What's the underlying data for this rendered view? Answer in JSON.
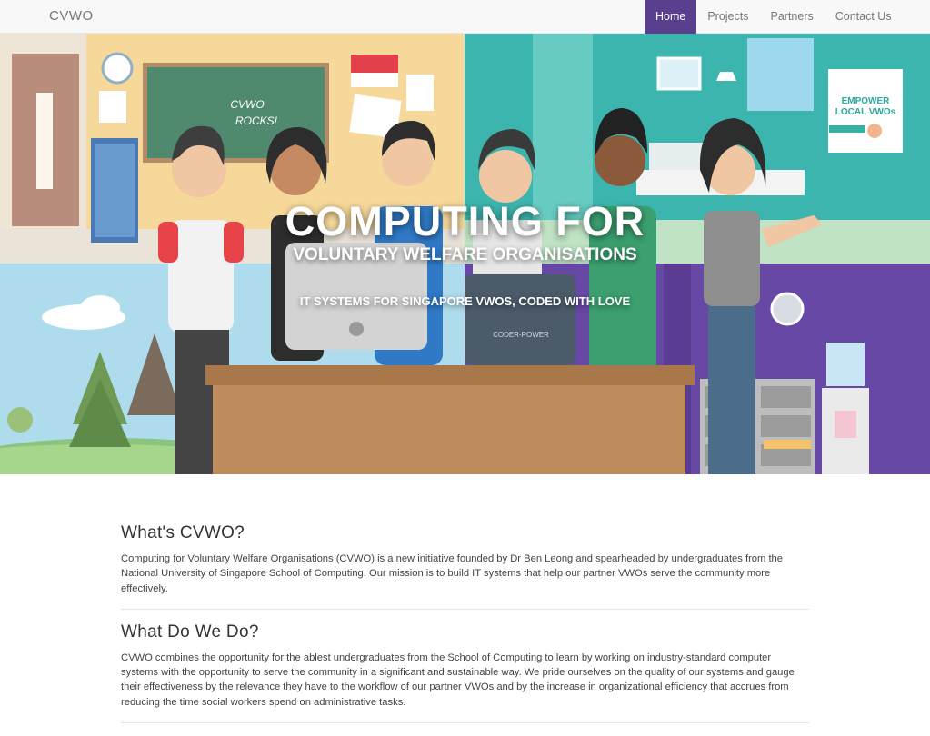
{
  "navbar": {
    "brand": "CVWO",
    "items": [
      {
        "label": "Home",
        "active": true
      },
      {
        "label": "Projects",
        "active": false
      },
      {
        "label": "Partners",
        "active": false
      },
      {
        "label": "Contact Us",
        "active": false
      }
    ],
    "active_color": "#5b3f8f"
  },
  "hero": {
    "title": "COMPUTING FOR",
    "subtitle": "VOLUNTARY WELFARE ORGANISATIONS",
    "tagline": "IT SYSTEMS FOR SINGAPORE VWOS, CODED WITH LOVE",
    "chalkboard_text_1": "CVWO",
    "chalkboard_text_2": "ROCKS!",
    "poster_text_1": "EMPOWER",
    "poster_text_2": "LOCAL VWOs",
    "laptop_text": "CODER-POWER"
  },
  "sections": [
    {
      "heading": "What's CVWO?",
      "body": "Computing for Voluntary Welfare Organisations (CVWO) is a new initiative founded by Dr Ben Leong and spearheaded by undergraduates from the National University of Singapore School of Computing. Our mission is to build IT systems that help our partner VWOs serve the community more effectively."
    },
    {
      "heading": "What Do We Do?",
      "body": "CVWO combines the opportunity for the ablest undergraduates from the School of Computing to learn by working on industry-standard computer systems with the opportunity to serve the community in a significant and sustainable way. We pride ourselves on the quality of our systems and gauge their effectiveness by the relevance they have to the workflow of our partner VWOs and by the increase in organizational efficiency that accrues from reducing the time social workers spend on administrative tasks."
    }
  ]
}
